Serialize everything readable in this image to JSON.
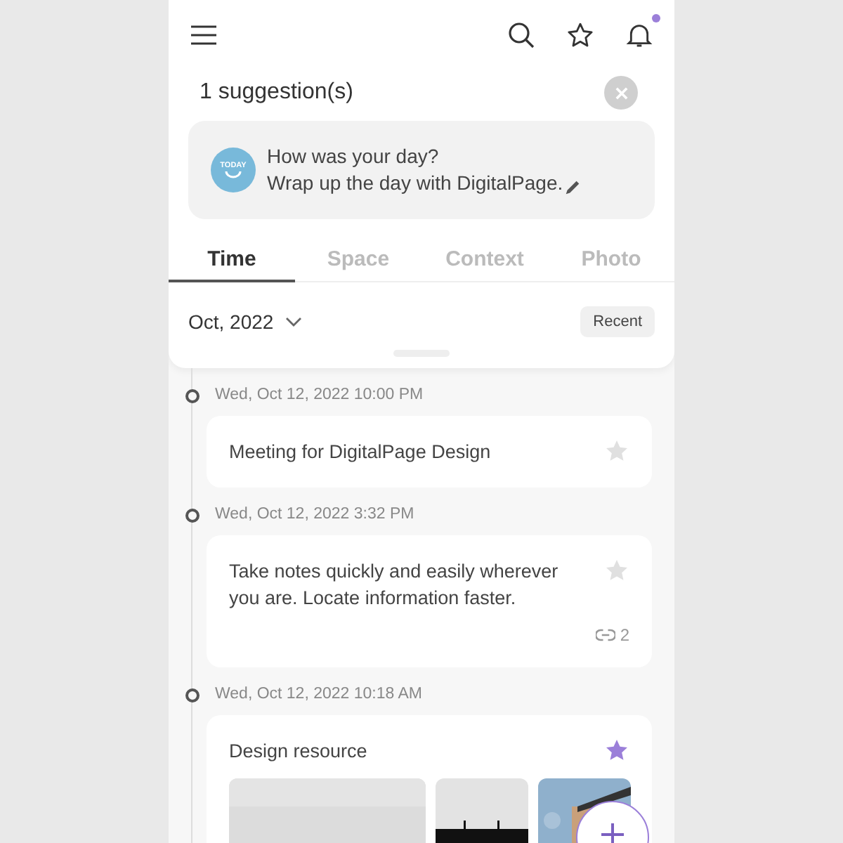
{
  "header": {
    "has_notification": true
  },
  "suggestions": {
    "title": "1 suggestion(s)",
    "card": {
      "badge": "TODAY",
      "lines": [
        "How was your day?",
        "Wrap up the day with DigitalPage."
      ]
    }
  },
  "tabs": [
    {
      "label": "Time",
      "selected": true
    },
    {
      "label": "Space",
      "selected": false
    },
    {
      "label": "Context",
      "selected": false
    },
    {
      "label": "Photo",
      "selected": false
    }
  ],
  "filter": {
    "month": "Oct, 2022",
    "sort": "Recent"
  },
  "entries": [
    {
      "time": "Wed, Oct 12, 2022 10:00 PM",
      "text": "Meeting for DigitalPage Design",
      "starred": false
    },
    {
      "time": "Wed, Oct 12, 2022 3:32 PM",
      "text": "Take notes quickly and easily wherever you are. Locate information faster.",
      "starred": false,
      "links": "2"
    },
    {
      "time": "Wed, Oct 12, 2022 10:18 AM",
      "text": "Design resource",
      "starred": true
    }
  ]
}
